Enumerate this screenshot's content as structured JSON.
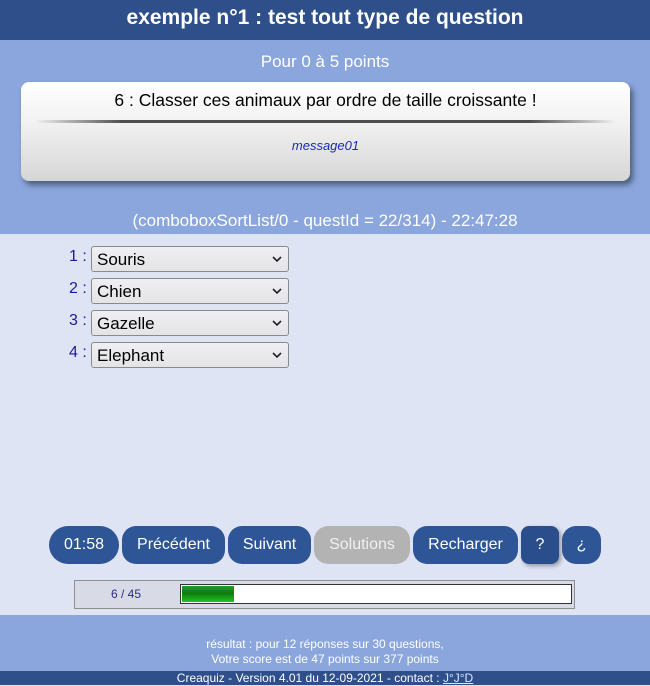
{
  "header": {
    "title": "exemple n°1 : test tout type de question"
  },
  "points_text": "Pour 0 à 5 points",
  "question": {
    "title": "6 : Classer ces animaux par ordre de taille croissante !",
    "message": "message01"
  },
  "question_info": "(comboboxSortList/0 - questId = 22/314) - 22:47:28",
  "answers": [
    {
      "num": "1 :",
      "value": "Souris"
    },
    {
      "num": "2 :",
      "value": "Chien"
    },
    {
      "num": "3 :",
      "value": "Gazelle"
    },
    {
      "num": "4 :",
      "value": "Elephant"
    }
  ],
  "controls": {
    "timer": "01:58",
    "previous": "Précédent",
    "next": "Suivant",
    "solutions": "Solutions",
    "reload": "Recharger",
    "help": "?",
    "inverted_help": "¿"
  },
  "progress": {
    "label": "6 / 45",
    "fraction": 0.133
  },
  "footer": {
    "line1": "résultat : pour 12 réponses sur 30 questions,",
    "line2": "Votre score est de 47 points sur 377 points",
    "credit": "Creaquiz - Version 4.01 du 12-09-2021 - contact :",
    "contact": "J°J°D"
  },
  "colors": {
    "header_bg": "#2e4f8a",
    "band_bg": "#8aa6dc",
    "page_bg": "#dfe4f5",
    "button_bg": "#2e5596",
    "button_disabled": "#b3b3b3",
    "progress_fill": "#1a9a1a"
  }
}
